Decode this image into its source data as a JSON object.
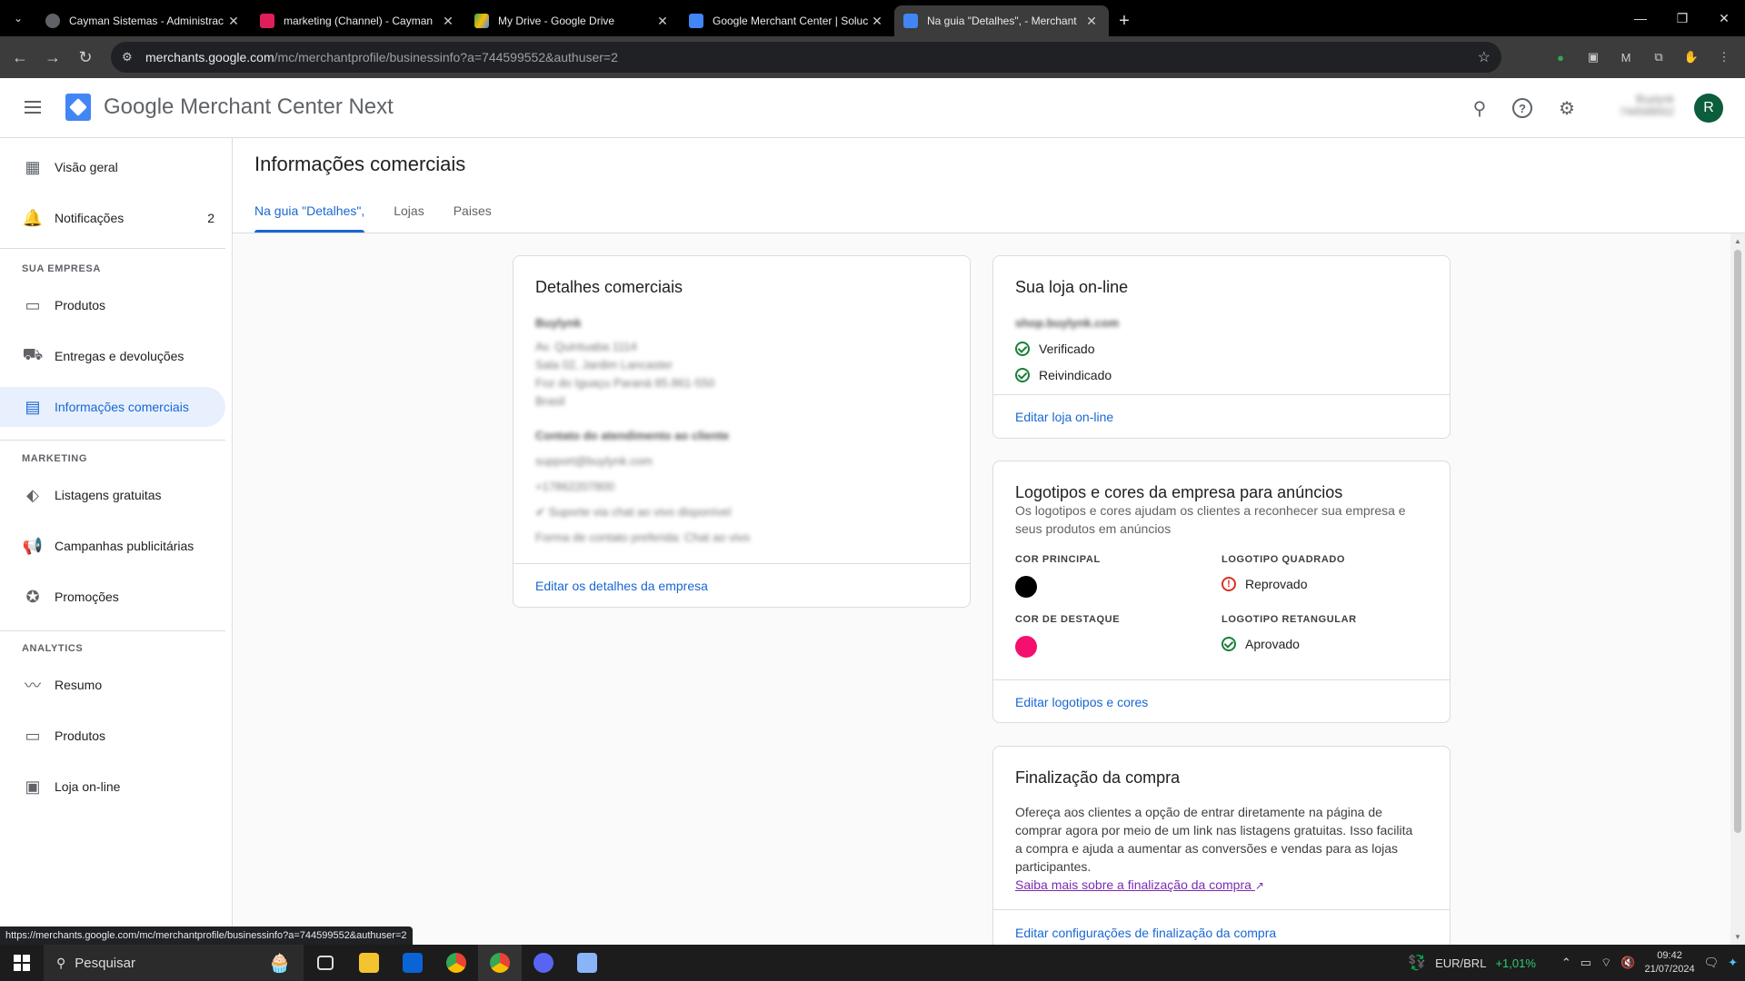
{
  "browser": {
    "tabs": [
      {
        "title": "Cayman Sistemas - Administrac",
        "icon": "globe-icon",
        "color": "#5f6368"
      },
      {
        "title": "marketing (Channel) - Cayman",
        "icon": "slack-icon",
        "color": "#e01e5a"
      },
      {
        "title": "My Drive - Google Drive",
        "icon": "drive-icon",
        "color": "#fbbc04"
      },
      {
        "title": "Google Merchant Center | Soluc",
        "icon": "docs-icon",
        "color": "#4285f4"
      },
      {
        "title": "Na guia \"Detalhes\", - Merchant",
        "icon": "merchant-icon",
        "color": "#4285f4"
      }
    ],
    "url_host": "merchants.google.com",
    "url_path": "/mc/merchantprofile/businessinfo?a=744599552&authuser=2",
    "status_url": "https://merchants.google.com/mc/merchantprofile/businessinfo?a=744599552&authuser=2"
  },
  "app": {
    "brand_google": "Google",
    "brand_product": "Merchant Center Next",
    "account_name": "Buylynk",
    "account_id": "744599552",
    "avatar_letter": "R"
  },
  "sidebar": {
    "overview": "Visão geral",
    "notifications": "Notificações",
    "notifications_count": "2",
    "section_business": "SUA EMPRESA",
    "products": "Produtos",
    "shipping": "Entregas e devoluções",
    "business_info": "Informações comerciais",
    "section_marketing": "MARKETING",
    "free_listings": "Listagens gratuitas",
    "campaigns": "Campanhas publicitárias",
    "promotions": "Promoções",
    "section_analytics": "ANALYTICS",
    "summary": "Resumo",
    "analytics_products": "Produtos",
    "online_store": "Loja on-line"
  },
  "page": {
    "title": "Informações comerciais",
    "tabs": [
      "Na guia \"Detalhes\",",
      "Lojas",
      "Paises"
    ]
  },
  "business_details": {
    "title": "Detalhes comerciais",
    "name": "Buylynk",
    "address_line1": "Av. Quintuaba 1114",
    "address_line2": "Sala 02, Jardim Lancaster",
    "address_line3": "Foz do Iguaçu Paraná 85.861-550",
    "address_line4": "Brasil",
    "contact_heading": "Contato do atendimento ao cliente",
    "email": "support@buylynk.com",
    "phone": "+17862207800",
    "chat": "Suporte via chat ao vivo disponível",
    "preferred": "Forma de contato preferida: Chat ao vivo",
    "edit_link": "Editar os detalhes da empresa"
  },
  "online_store": {
    "title": "Sua loja on-line",
    "domain": "shop.buylynk.com",
    "verified": "Verificado",
    "claimed": "Reivindicado",
    "edit_link": "Editar loja on-line"
  },
  "logos": {
    "title": "Logotipos e cores da empresa para anúncios",
    "description": "Os logotipos e cores ajudam os clientes a reconhecer sua empresa e seus produtos em anúncios",
    "main_color_label": "COR PRINCIPAL",
    "main_color": "#000000",
    "square_logo_label": "LOGOTIPO QUADRADO",
    "square_logo_status": "Reprovado",
    "accent_color_label": "COR DE DESTAQUE",
    "accent_color": "#f50f6e",
    "rect_logo_label": "LOGOTIPO RETANGULAR",
    "rect_logo_status": "Aprovado",
    "edit_link": "Editar logotipos e cores"
  },
  "checkout": {
    "title": "Finalização da compra",
    "body": "Ofereça aos clientes a opção de entrar diretamente na página de comprar agora por meio de um link nas listagens gratuitas. Isso facilita a compra e ajuda a aumentar as conversões e vendas para as lojas participantes.",
    "learn_more": "Saiba mais sobre a finalização da compra",
    "edit_link": "Editar configurações de finalização da compra"
  },
  "taskbar": {
    "search": "Pesquisar",
    "currency": "EUR/BRL",
    "currency_change": "+1,01%",
    "time": "09:42",
    "date": "21/07/2024"
  }
}
